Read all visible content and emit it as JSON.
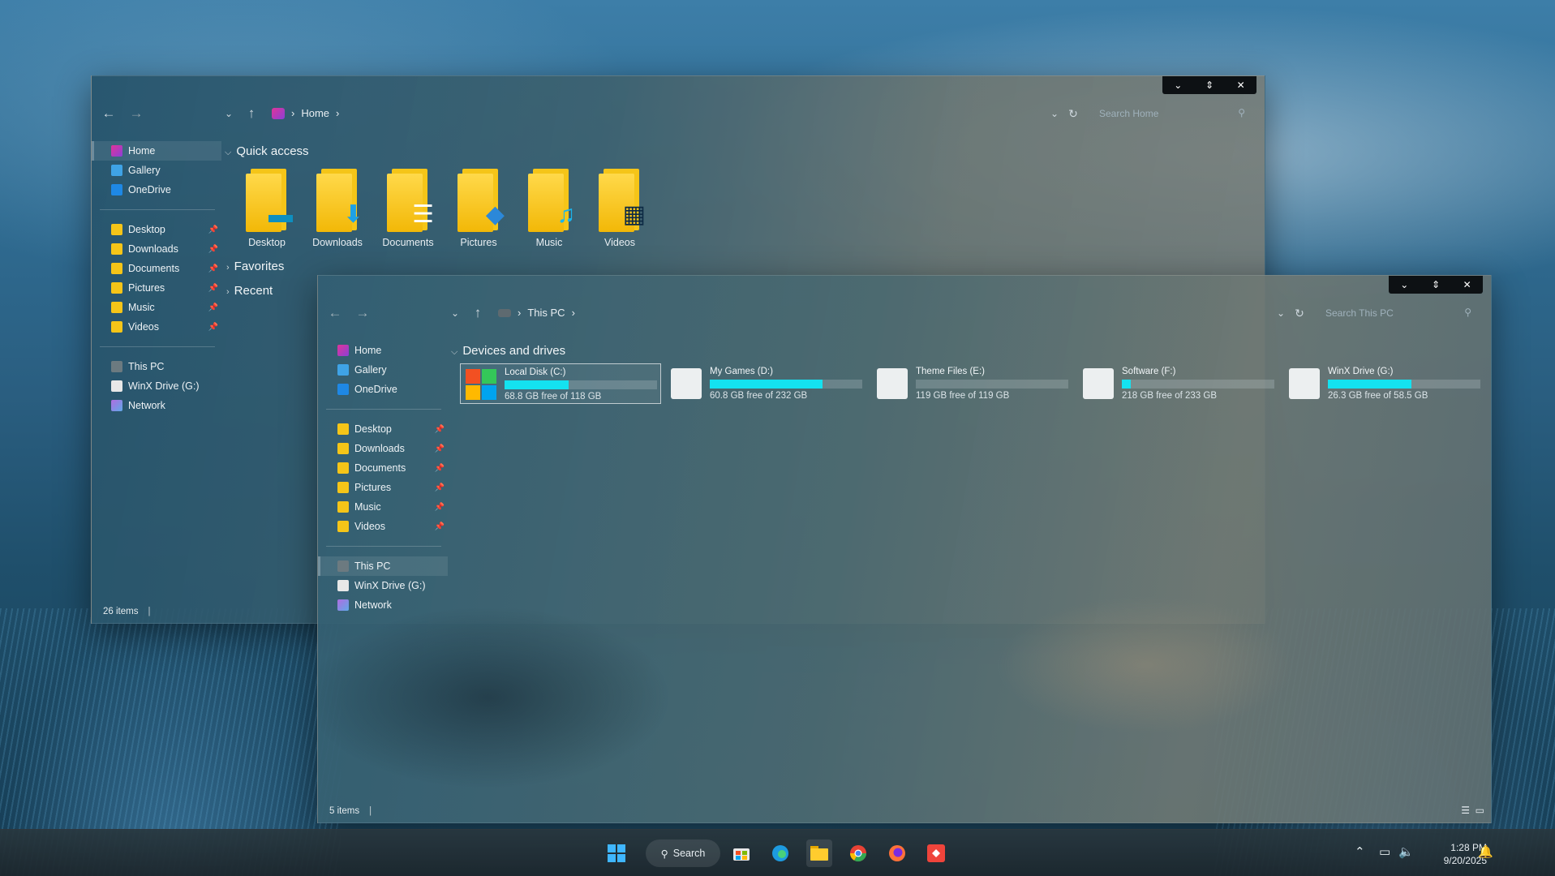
{
  "window_home": {
    "controls": [
      "⌄",
      "⇕",
      "✕"
    ],
    "breadcrumb": [
      "Home"
    ],
    "search_placeholder": "Search Home",
    "sidebar": [
      {
        "label": "Home",
        "icon": "home-icon",
        "color": "#e0349a",
        "selected": true
      },
      {
        "label": "Gallery",
        "icon": "gallery-icon",
        "color": "#3fa3e6"
      },
      {
        "label": "OneDrive",
        "icon": "onedrive-icon",
        "color": "#1e88e5"
      }
    ],
    "pinned": [
      {
        "label": "Desktop",
        "icon": "desktop-folder-icon"
      },
      {
        "label": "Downloads",
        "icon": "downloads-folder-icon"
      },
      {
        "label": "Documents",
        "icon": "documents-folder-icon"
      },
      {
        "label": "Pictures",
        "icon": "pictures-folder-icon"
      },
      {
        "label": "Music",
        "icon": "music-folder-icon"
      },
      {
        "label": "Videos",
        "icon": "videos-folder-icon"
      }
    ],
    "devices": [
      {
        "label": "This PC",
        "icon": "this-pc-icon"
      },
      {
        "label": "WinX Drive (G:)",
        "icon": "drive-icon"
      },
      {
        "label": "Network",
        "icon": "network-icon"
      }
    ],
    "quick_access_title": "Quick access",
    "quick_access": [
      {
        "label": "Desktop",
        "glyph": "▬"
      },
      {
        "label": "Downloads",
        "glyph": "⬇"
      },
      {
        "label": "Documents",
        "glyph": "☰"
      },
      {
        "label": "Pictures",
        "glyph": "◆"
      },
      {
        "label": "Music",
        "glyph": "♫"
      },
      {
        "label": "Videos",
        "glyph": "▦"
      }
    ],
    "favorites": "Favorites",
    "recent": "Recent",
    "status": "26 items"
  },
  "window_pc": {
    "controls": [
      "⌄",
      "⇕",
      "✕"
    ],
    "breadcrumb": [
      "This PC"
    ],
    "search_placeholder": "Search This PC",
    "sidebar": [
      {
        "label": "Home"
      },
      {
        "label": "Gallery"
      },
      {
        "label": "OneDrive"
      }
    ],
    "pinned": [
      {
        "label": "Desktop"
      },
      {
        "label": "Downloads"
      },
      {
        "label": "Documents"
      },
      {
        "label": "Pictures"
      },
      {
        "label": "Music"
      },
      {
        "label": "Videos"
      }
    ],
    "devices": [
      {
        "label": "This PC",
        "selected": true
      },
      {
        "label": "WinX Drive (G:)"
      },
      {
        "label": "Network"
      }
    ],
    "section_title": "Devices and drives",
    "drives": [
      {
        "name": "Local Disk (C:)",
        "free": "68.8 GB free of 118 GB",
        "used_fraction": 0.42,
        "selected": true
      },
      {
        "name": "My Games (D:)",
        "free": "60.8 GB free of 232 GB",
        "used_fraction": 0.74
      },
      {
        "name": "Theme Files (E:)",
        "free": "119 GB free of 119 GB",
        "used_fraction": 0.0
      },
      {
        "name": "Software (F:)",
        "free": "218 GB free of 233 GB",
        "used_fraction": 0.06
      },
      {
        "name": "WinX Drive (G:)",
        "free": "26.3 GB free of 58.5 GB",
        "used_fraction": 0.55
      }
    ],
    "status": "5 items"
  },
  "taskbar": {
    "search_label": "Search",
    "time": "1:28 PM",
    "date": "9/20/2025",
    "accent": "#14e2f0"
  }
}
